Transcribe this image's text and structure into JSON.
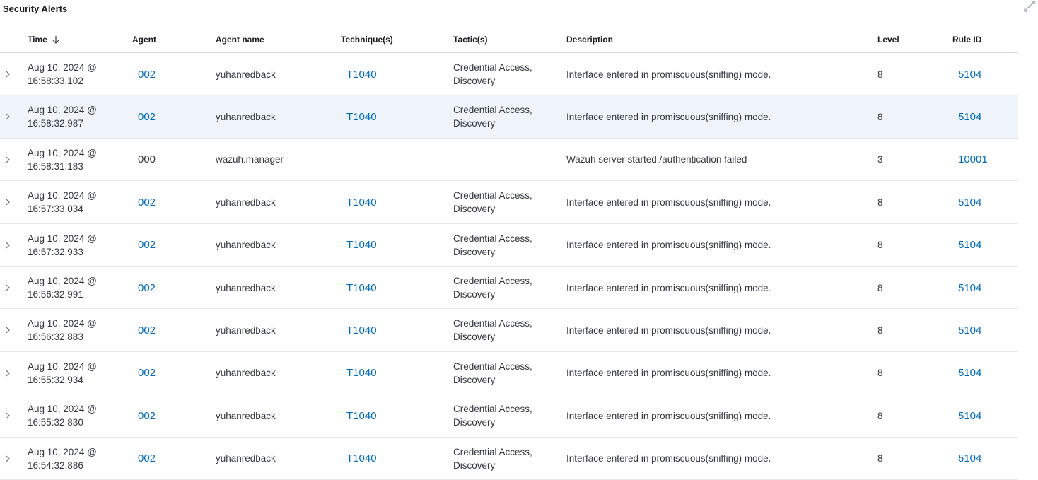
{
  "panel": {
    "title": "Security Alerts",
    "expand_icon": "expand-arrows-icon"
  },
  "columns": {
    "time": "Time",
    "agent": "Agent",
    "agent_name": "Agent name",
    "techniques": "Technique(s)",
    "tactics": "Tactic(s)",
    "description": "Description",
    "level": "Level",
    "rule_id": "Rule ID"
  },
  "sort_icon": "arrow-down-icon",
  "colors": {
    "link": "#006bb8",
    "highlight_row": "#eef4f9",
    "border": "#d3dae6"
  },
  "rows": [
    {
      "time_line1": "Aug 10, 2024 @",
      "time_line2": "16:58:33.102",
      "agent": "002",
      "agent_link": true,
      "agent_name": "yuhanredback",
      "technique": "T1040",
      "tactic_line1": "Credential Access,",
      "tactic_line2": "Discovery",
      "description": "Interface entered in promiscuous(sniffing) mode.",
      "level": "8",
      "rule_id": "5104",
      "highlight": false
    },
    {
      "time_line1": "Aug 10, 2024 @",
      "time_line2": "16:58:32.987",
      "agent": "002",
      "agent_link": true,
      "agent_name": "yuhanredback",
      "technique": "T1040",
      "tactic_line1": "Credential Access,",
      "tactic_line2": "Discovery",
      "description": "Interface entered in promiscuous(sniffing) mode.",
      "level": "8",
      "rule_id": "5104",
      "highlight": true
    },
    {
      "time_line1": "Aug 10, 2024 @",
      "time_line2": "16:58:31.183",
      "agent": "000",
      "agent_link": false,
      "agent_name": "wazuh.manager",
      "technique": "",
      "tactic_line1": "",
      "tactic_line2": "",
      "description": "Wazuh server started./authentication failed",
      "level": "3",
      "rule_id": "10001",
      "highlight": false
    },
    {
      "time_line1": "Aug 10, 2024 @",
      "time_line2": "16:57:33.034",
      "agent": "002",
      "agent_link": true,
      "agent_name": "yuhanredback",
      "technique": "T1040",
      "tactic_line1": "Credential Access,",
      "tactic_line2": "Discovery",
      "description": "Interface entered in promiscuous(sniffing) mode.",
      "level": "8",
      "rule_id": "5104",
      "highlight": false
    },
    {
      "time_line1": "Aug 10, 2024 @",
      "time_line2": "16:57:32.933",
      "agent": "002",
      "agent_link": true,
      "agent_name": "yuhanredback",
      "technique": "T1040",
      "tactic_line1": "Credential Access,",
      "tactic_line2": "Discovery",
      "description": "Interface entered in promiscuous(sniffing) mode.",
      "level": "8",
      "rule_id": "5104",
      "highlight": false
    },
    {
      "time_line1": "Aug 10, 2024 @",
      "time_line2": "16:56:32.991",
      "agent": "002",
      "agent_link": true,
      "agent_name": "yuhanredback",
      "technique": "T1040",
      "tactic_line1": "Credential Access,",
      "tactic_line2": "Discovery",
      "description": "Interface entered in promiscuous(sniffing) mode.",
      "level": "8",
      "rule_id": "5104",
      "highlight": false
    },
    {
      "time_line1": "Aug 10, 2024 @",
      "time_line2": "16:56:32.883",
      "agent": "002",
      "agent_link": true,
      "agent_name": "yuhanredback",
      "technique": "T1040",
      "tactic_line1": "Credential Access,",
      "tactic_line2": "Discovery",
      "description": "Interface entered in promiscuous(sniffing) mode.",
      "level": "8",
      "rule_id": "5104",
      "highlight": false
    },
    {
      "time_line1": "Aug 10, 2024 @",
      "time_line2": "16:55:32.934",
      "agent": "002",
      "agent_link": true,
      "agent_name": "yuhanredback",
      "technique": "T1040",
      "tactic_line1": "Credential Access,",
      "tactic_line2": "Discovery",
      "description": "Interface entered in promiscuous(sniffing) mode.",
      "level": "8",
      "rule_id": "5104",
      "highlight": false
    },
    {
      "time_line1": "Aug 10, 2024 @",
      "time_line2": "16:55:32.830",
      "agent": "002",
      "agent_link": true,
      "agent_name": "yuhanredback",
      "technique": "T1040",
      "tactic_line1": "Credential Access,",
      "tactic_line2": "Discovery",
      "description": "Interface entered in promiscuous(sniffing) mode.",
      "level": "8",
      "rule_id": "5104",
      "highlight": false
    },
    {
      "time_line1": "Aug 10, 2024 @",
      "time_line2": "16:54:32.886",
      "agent": "002",
      "agent_link": true,
      "agent_name": "yuhanredback",
      "technique": "T1040",
      "tactic_line1": "Credential Access,",
      "tactic_line2": "Discovery",
      "description": "Interface entered in promiscuous(sniffing) mode.",
      "level": "8",
      "rule_id": "5104",
      "highlight": false
    }
  ]
}
